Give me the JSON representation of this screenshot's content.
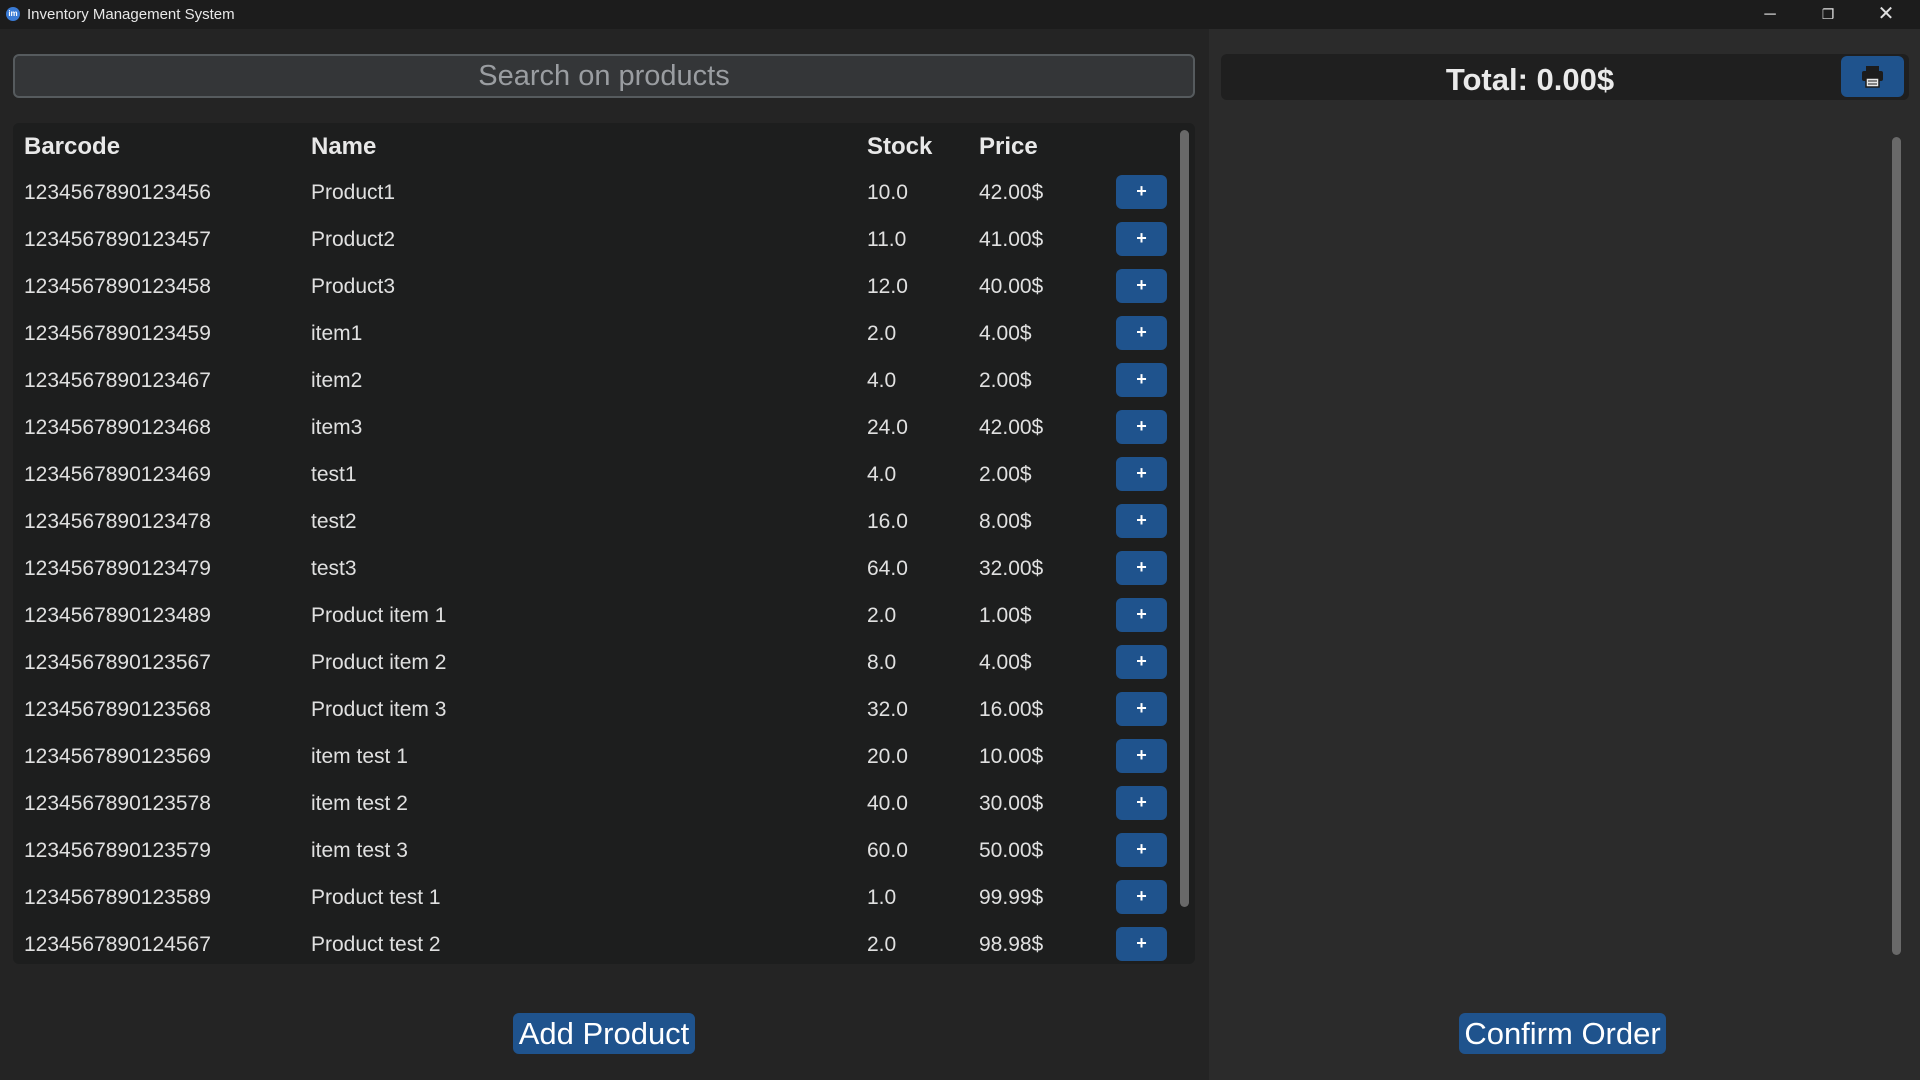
{
  "window": {
    "icon": "im",
    "title": "Inventory Management System",
    "minimize": "─",
    "maximize": "❐",
    "close": "✕"
  },
  "search": {
    "placeholder": "Search on products"
  },
  "table": {
    "headers": {
      "barcode": "Barcode",
      "name": "Name",
      "stock": "Stock",
      "price": "Price"
    },
    "add_label": "+",
    "rows": [
      {
        "barcode": "1234567890123456",
        "name": "Product1",
        "stock": "10.0",
        "price": "42.00$"
      },
      {
        "barcode": "1234567890123457",
        "name": "Product2",
        "stock": "11.0",
        "price": "41.00$"
      },
      {
        "barcode": "1234567890123458",
        "name": "Product3",
        "stock": "12.0",
        "price": "40.00$"
      },
      {
        "barcode": "1234567890123459",
        "name": "item1",
        "stock": "2.0",
        "price": "4.00$"
      },
      {
        "barcode": "1234567890123467",
        "name": "item2",
        "stock": "4.0",
        "price": "2.00$"
      },
      {
        "barcode": "1234567890123468",
        "name": "item3",
        "stock": "24.0",
        "price": "42.00$"
      },
      {
        "barcode": "1234567890123469",
        "name": "test1",
        "stock": "4.0",
        "price": "2.00$"
      },
      {
        "barcode": "1234567890123478",
        "name": "test2",
        "stock": "16.0",
        "price": "8.00$"
      },
      {
        "barcode": "1234567890123479",
        "name": "test3",
        "stock": "64.0",
        "price": "32.00$"
      },
      {
        "barcode": "1234567890123489",
        "name": "Product item 1",
        "stock": "2.0",
        "price": "1.00$"
      },
      {
        "barcode": "1234567890123567",
        "name": "Product item 2",
        "stock": "8.0",
        "price": "4.00$"
      },
      {
        "barcode": "1234567890123568",
        "name": "Product item 3",
        "stock": "32.0",
        "price": "16.00$"
      },
      {
        "barcode": "1234567890123569",
        "name": "item test 1",
        "stock": "20.0",
        "price": "10.00$"
      },
      {
        "barcode": "1234567890123578",
        "name": "item test 2",
        "stock": "40.0",
        "price": "30.00$"
      },
      {
        "barcode": "1234567890123579",
        "name": "item test 3",
        "stock": "60.0",
        "price": "50.00$"
      },
      {
        "barcode": "1234567890123589",
        "name": "Product test 1",
        "stock": "1.0",
        "price": "99.99$"
      },
      {
        "barcode": "1234567890124567",
        "name": "Product test 2",
        "stock": "2.0",
        "price": "98.98$"
      }
    ]
  },
  "buttons": {
    "add_product": "Add Product",
    "confirm_order": "Confirm Order",
    "print_icon": "printer-icon"
  },
  "cart": {
    "total": "Total: 0.00$"
  },
  "colors": {
    "accent": "#1f538d",
    "background": "#242424",
    "table_bg": "#1d1e1e"
  }
}
